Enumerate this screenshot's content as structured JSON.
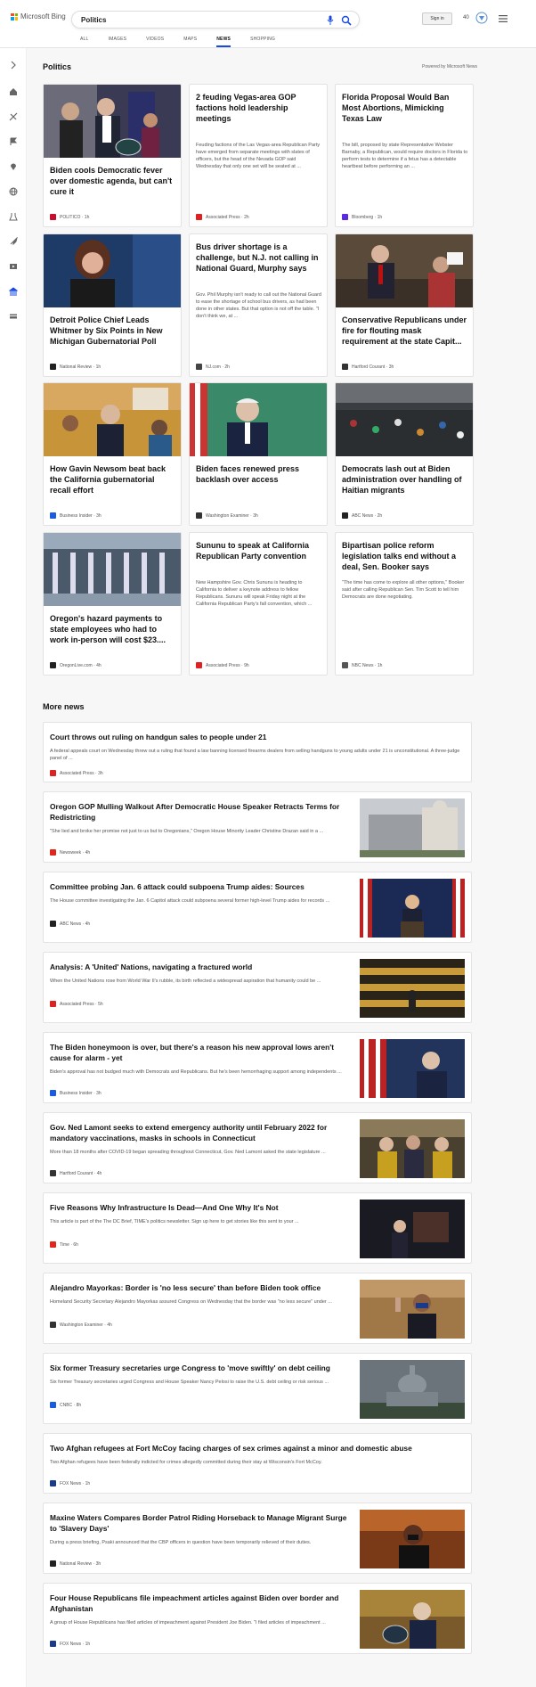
{
  "header": {
    "brand": "Microsoft Bing",
    "query": "Politics",
    "tabs": [
      "ALL",
      "IMAGES",
      "VIDEOS",
      "MAPS",
      "NEWS",
      "SHOPPING"
    ],
    "active_tab": "NEWS",
    "sign_in": "Sign in",
    "points": "40"
  },
  "section": {
    "title": "Politics",
    "powered": "Powered by Microsoft News"
  },
  "cards": [
    {
      "title": "Biden cools Democratic fever over domestic agenda, but can't cure it",
      "snippet": "",
      "source": "POLITICO",
      "time": "1h",
      "color": "#c8102e"
    },
    {
      "title": "2 feuding Vegas-area GOP factions hold leadership meetings",
      "snippet": "Feuding factions of the Las Vegas-area Republican Party have emerged from separate meetings with slates of officers, but the head of the Nevada GOP said Wednesday that only one set will be seated at ...",
      "source": "Associated Press",
      "time": "2h",
      "color": "#d22"
    },
    {
      "title": "Florida Proposal Would Ban Most Abortions, Mimicking Texas Law",
      "snippet": "The bill, proposed by state Representative Webster Barnaby, a Republican, would require doctors in Florida to perform tests to determine if a fetus has a detectable heartbeat before performing an ...",
      "source": "Bloomberg",
      "time": "1h",
      "color": "#5a2be0"
    },
    {
      "title": "Detroit Police Chief Leads Whitmer by Six Points in New Michigan Gubernatorial Poll",
      "snippet": "",
      "source": "National Review",
      "time": "1h",
      "color": "#222"
    },
    {
      "title": "Bus driver shortage is a challenge, but N.J. not calling in National Guard, Murphy says",
      "snippet": "Gov. Phil Murphy isn't ready to call out the National Guard to ease the shortage of school bus drivers, as had been done in other states. But that option is not off the table. \"I don't think we, at ...",
      "source": "NJ.com",
      "time": "2h",
      "color": "#444"
    },
    {
      "title": "Conservative Republicans under fire for flouting mask requirement at the state Capit...",
      "snippet": "",
      "source": "Hartford Courant",
      "time": "3h",
      "color": "#333"
    },
    {
      "title": "How Gavin Newsom beat back the California gubernatorial recall effort",
      "snippet": "",
      "source": "Business Insider",
      "time": "3h",
      "color": "#1a5ce0"
    },
    {
      "title": "Biden faces renewed press backlash over access",
      "snippet": "",
      "source": "Washington Examiner",
      "time": "3h",
      "color": "#333"
    },
    {
      "title": "Democrats lash out at Biden administration over handling of Haitian migrants",
      "snippet": "",
      "source": "ABC News",
      "time": "2h",
      "color": "#222"
    },
    {
      "title": "Oregon's hazard payments to state employees who had to work in-person will cost $23....",
      "snippet": "",
      "source": "OregonLive.com",
      "time": "4h",
      "color": "#222"
    },
    {
      "title": "Sununu to speak at California Republican Party convention",
      "snippet": "New Hampshire Gov. Chris Sununu is heading to California to deliver a keynote address to fellow Republicans. Sununu will speak Friday night at the California Republican Party's fall convention, which ...",
      "source": "Associated Press",
      "time": "9h",
      "color": "#d22"
    },
    {
      "title": "Bipartisan police reform legislation talks end without a deal, Sen. Booker says",
      "snippet": "\"The time has come to explore all other options,\" Booker said after calling Republican Sen. Tim Scott to tell him Democrats are done negotiating.",
      "source": "NBC News",
      "time": "1h",
      "color": "#555"
    }
  ],
  "more_news": {
    "title": "More news",
    "items": [
      {
        "title": "Court throws out ruling on handgun sales to people under 21",
        "snippet": "A federal appeals court on Wednesday threw out a ruling that found a law banning licensed firearms dealers from selling handguns to young adults under 21 is unconstitutional. A three-judge panel of ...",
        "source": "Associated Press",
        "time": "3h",
        "color": "#d22",
        "thumb": false
      },
      {
        "title": "Oregon GOP Mulling Walkout After Democratic House Speaker Retracts Terms for Redistricting",
        "snippet": "\"She lied and broke her promise not just to us but to Oregonians,\" Oregon House Minority Leader Christine Drazan said in a ...",
        "source": "Newsweek",
        "time": "4h",
        "color": "#e1261c",
        "thumb": true
      },
      {
        "title": "Committee probing Jan. 6 attack could subpoena Trump aides: Sources",
        "snippet": "The House committee investigating the Jan. 6 Capitol attack could subpoena several former high-level Trump aides for records ...",
        "source": "ABC News",
        "time": "4h",
        "color": "#222",
        "thumb": true
      },
      {
        "title": "Analysis: A 'United' Nations, navigating a fractured world",
        "snippet": "When the United Nations rose from World War II's rubble, its birth reflected a widespread aspiration that humanity could be ...",
        "source": "Associated Press",
        "time": "5h",
        "color": "#d22",
        "thumb": true
      },
      {
        "title": "The Biden honeymoon is over, but there's a reason his new approval lows aren't cause for alarm - yet",
        "snippet": "Biden's approval has not budged much with Democrats and Republicans. But he's been hemorrhaging support among independents ...",
        "source": "Business Insider",
        "time": "3h",
        "color": "#1a5ce0",
        "thumb": true
      },
      {
        "title": "Gov. Ned Lamont seeks to extend emergency authority until February 2022 for mandatory vaccinations, masks in schools in Connecticut",
        "snippet": "More than 18 months after COVID-19 began spreading throughout Connecticut, Gov. Ned Lamont asked the state legislature ...",
        "source": "Hartford Courant",
        "time": "4h",
        "color": "#333",
        "thumb": true
      },
      {
        "title": "Five Reasons Why Infrastructure Is Dead—And One Why It's Not",
        "snippet": "This article is part of the The DC Brief, TIME's politics newsletter. Sign up here to get stories like this sent to your ...",
        "source": "Time",
        "time": "6h",
        "color": "#e1261c",
        "thumb": true
      },
      {
        "title": "Alejandro Mayorkas: Border is 'no less secure' than before Biden took office",
        "snippet": "Homeland Security Secretary Alejandro Mayorkas assured Congress on Wednesday that the border was \"no less secure\" under ...",
        "source": "Washington Examiner",
        "time": "4h",
        "color": "#333",
        "thumb": true
      },
      {
        "title": "Six former Treasury secretaries urge Congress to 'move swiftly' on debt ceiling",
        "snippet": "Six former Treasury secretaries urged Congress and House Speaker Nancy Pelosi to raise the U.S. debt ceiling or risk serious ...",
        "source": "CNBC",
        "time": "8h",
        "color": "#1a5ce0",
        "thumb": true
      },
      {
        "title": "Two Afghan refugees at Fort McCoy facing charges of sex crimes against a minor and domestic abuse",
        "snippet": "Two Afghan refugees have been federally indicted for crimes allegedly committed during their stay at Wisconsin's Fort McCoy.",
        "source": "FOX News",
        "time": "1h",
        "color": "#1a3a8a",
        "thumb": false
      },
      {
        "title": "Maxine Waters Compares Border Patrol Riding Horseback to Manage Migrant Surge to 'Slavery Days'",
        "snippet": "During a press briefing, Psaki announced that the CBP officers in question have been temporarily relieved of their duties.",
        "source": "National Review",
        "time": "3h",
        "color": "#222",
        "thumb": true
      },
      {
        "title": "Four House Republicans file impeachment articles against Biden over border and Afghanistan",
        "snippet": "A group of House Republicans has filed articles of impeachment against President Joe Biden. \"I filed articles of impeachment ...",
        "source": "FOX News",
        "time": "1h",
        "color": "#1a3a8a",
        "thumb": true
      }
    ]
  }
}
